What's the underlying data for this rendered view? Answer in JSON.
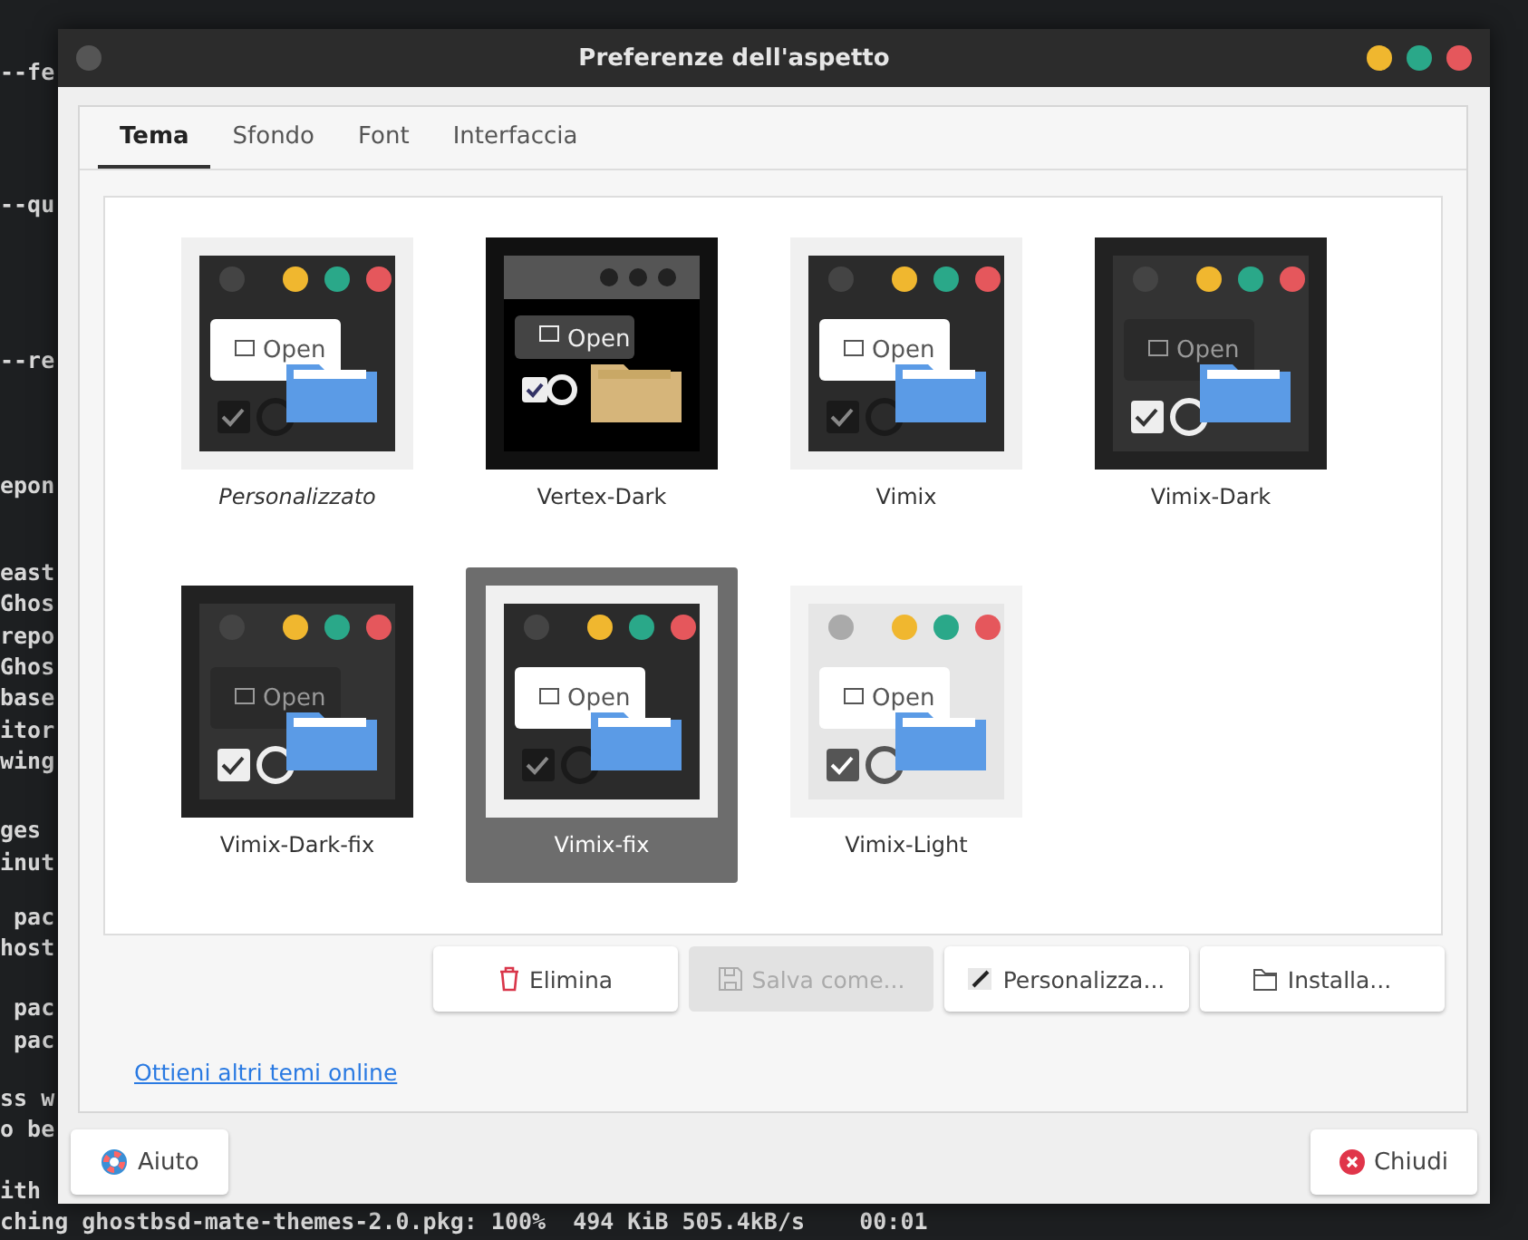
{
  "terminal": {
    "blocks": [
      [
        "--fe"
      ],
      [
        "--qu"
      ],
      [
        "--re"
      ],
      [
        "epon"
      ],
      [
        "east",
        "Ghos",
        "repo",
        "Ghos",
        "base",
        "itor",
        "wing"
      ],
      [
        "ges",
        "inut"
      ],
      [
        " pac",
        "host"
      ],
      [
        " pac",
        " pac"
      ],
      [
        "ss w",
        "o be"
      ],
      [
        "ith",
        "ching ghostbsd-mate-themes-2.0.pkg: 100%  494 KiB 505.4kB/s    00:01"
      ]
    ]
  },
  "window": {
    "title": "Preferenze dell'aspetto"
  },
  "tabs": [
    {
      "label": "Tema",
      "selected": true
    },
    {
      "label": "Sfondo",
      "selected": false
    },
    {
      "label": "Font",
      "selected": false
    },
    {
      "label": "Interfaccia",
      "selected": false
    }
  ],
  "themes": [
    {
      "name": "Personalizzato",
      "kind": "custom",
      "preview_label": "Open",
      "selected": false
    },
    {
      "name": "Vertex-Dark",
      "kind": "theme",
      "preview_label": "Open",
      "selected": false
    },
    {
      "name": "Vimix",
      "kind": "theme",
      "preview_label": "Open",
      "selected": false
    },
    {
      "name": "Vimix-Dark",
      "kind": "theme",
      "preview_label": "Open",
      "selected": false
    },
    {
      "name": "Vimix-Dark-fix",
      "kind": "theme",
      "preview_label": "Open",
      "selected": false
    },
    {
      "name": "Vimix-fix",
      "kind": "theme",
      "preview_label": "Open",
      "selected": true
    },
    {
      "name": "Vimix-Light",
      "kind": "theme",
      "preview_label": "Open",
      "selected": false
    }
  ],
  "actions": [
    {
      "label": "Elimina",
      "disabled": false
    },
    {
      "label": "Salva come...",
      "disabled": true
    },
    {
      "label": "Personalizza...",
      "disabled": false
    },
    {
      "label": "Installa...",
      "disabled": false
    }
  ],
  "link": "Ottieni altri temi online",
  "footer": {
    "help": "Aiuto",
    "close": "Chiudi"
  }
}
